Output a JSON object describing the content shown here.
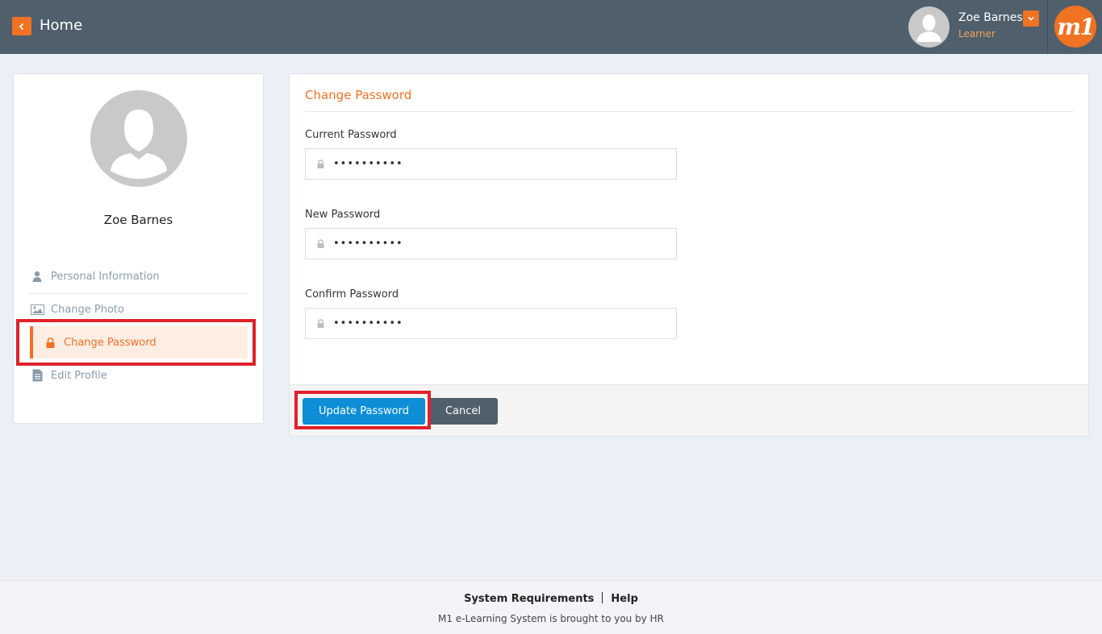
{
  "header": {
    "back_label": "Home",
    "user_name": "Zoe Barnes",
    "user_role": "Learner",
    "logo_text": "m1",
    "accent_color": "#f07223",
    "bar_color": "#4f5f6b"
  },
  "profile": {
    "name": "Zoe Barnes",
    "menu": [
      {
        "label": "Personal Information",
        "icon": "user-icon",
        "active": false
      },
      {
        "label": "Change Photo",
        "icon": "image-icon",
        "active": false
      },
      {
        "label": "Change Password",
        "icon": "lock-icon",
        "active": true
      },
      {
        "label": "Edit Profile",
        "icon": "document-icon",
        "active": false
      }
    ]
  },
  "form": {
    "title": "Change Password",
    "fields": [
      {
        "label": "Current Password",
        "value": "••••••••••"
      },
      {
        "label": "New Password",
        "value": "••••••••••"
      },
      {
        "label": "Confirm Password",
        "value": "••••••••••"
      }
    ],
    "update_label": "Update Password",
    "cancel_label": "Cancel",
    "primary_color": "#0d8ed7"
  },
  "footer": {
    "links": [
      "System Requirements",
      "Help"
    ],
    "note": "M1 e-Learning System is brought to you by HR"
  }
}
